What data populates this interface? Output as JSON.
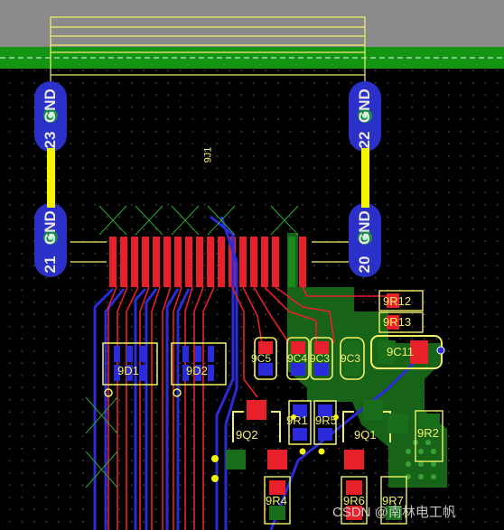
{
  "connector": {
    "ref": "9J1",
    "pins": [
      {
        "number": "23",
        "net": "GND"
      },
      {
        "number": "22",
        "net": "GND"
      },
      {
        "number": "21",
        "net": "GND"
      },
      {
        "number": "20",
        "net": "GND"
      }
    ]
  },
  "components": {
    "d1": "9D1",
    "d2": "9D2",
    "r12": "9R12",
    "r13": "9R13",
    "c11": "9C11",
    "c3": "9C3",
    "c_a": "9C5",
    "c_b": "9C4",
    "c_c": "9C3",
    "r1": "9R1",
    "r5": "9R5",
    "q2": "9Q2",
    "q1": "9Q1",
    "r2": "9R2",
    "r4": "9R4",
    "r6": "9R6",
    "r7": "9R7"
  },
  "watermark": "CSDN @南林电工帆",
  "colors": {
    "top_copper": "#e8202a",
    "bottom_copper": "#2b2bdb",
    "silkscreen": "#f2f266",
    "ground_pour": "#1a6e1a",
    "board_edge": "#1f9e1f"
  }
}
